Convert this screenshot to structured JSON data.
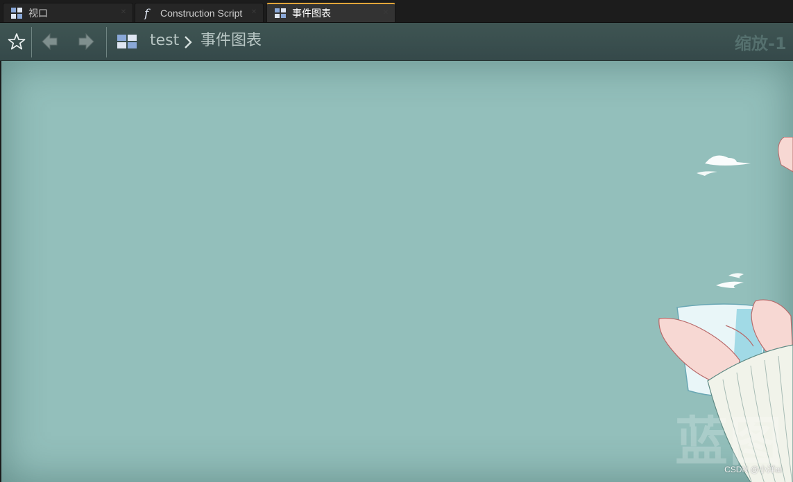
{
  "tabs": [
    {
      "label": "视口",
      "icon": "viewport-grid-icon",
      "active": false
    },
    {
      "label": "Construction Script",
      "icon": "function-icon",
      "active": false
    },
    {
      "label": "事件图表",
      "icon": "event-graph-icon",
      "active": true
    }
  ],
  "toolbar": {
    "favorite_icon": "star-icon",
    "back_icon": "back-arrow-icon",
    "forward_icon": "forward-arrow-icon",
    "graph_icon": "event-graph-icon",
    "breadcrumb": {
      "root": "test",
      "separator": "›",
      "current": "事件图表"
    },
    "zoom_label": "缩放-1"
  },
  "canvas": {
    "background_color": "#93bfbb",
    "watermark": "蓝图",
    "credit": "CSDN @小洋ai"
  },
  "colors": {
    "active_tab_accent": "#e2a63a",
    "toolbar": "#3f5553"
  }
}
